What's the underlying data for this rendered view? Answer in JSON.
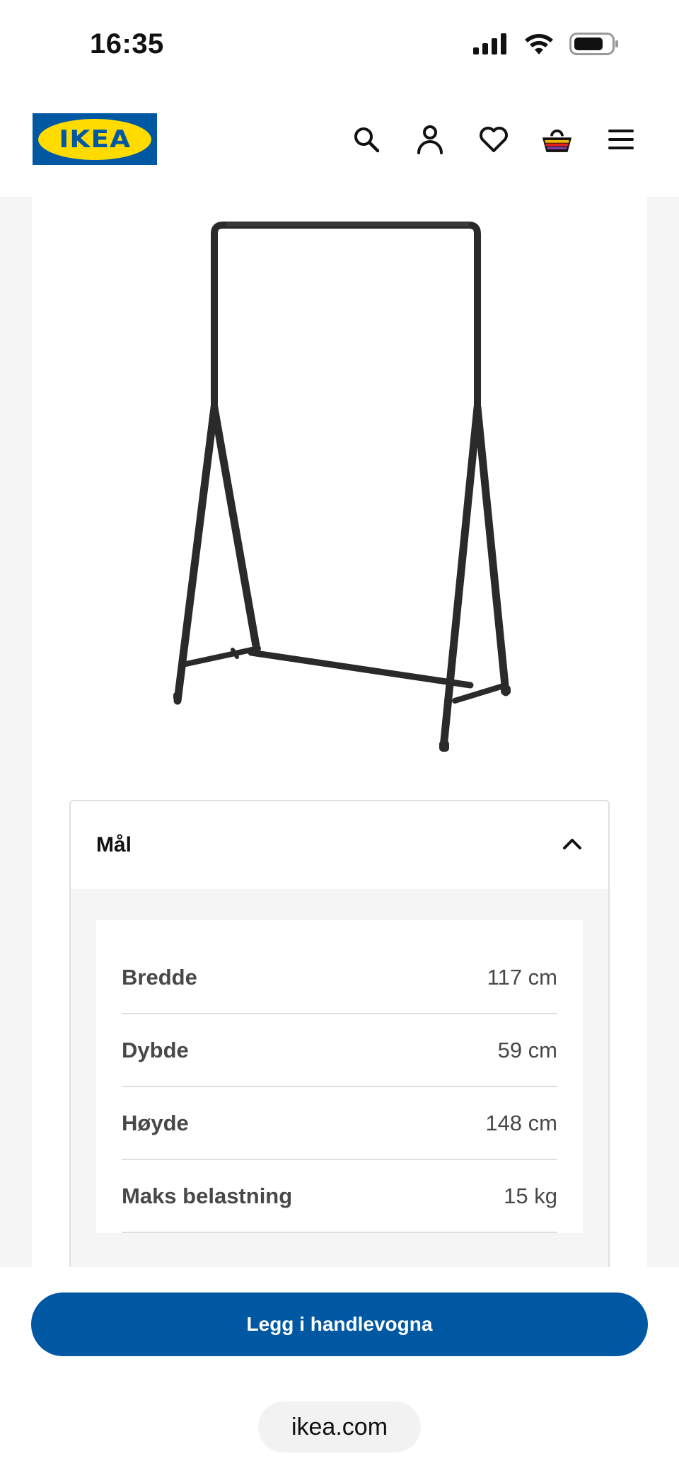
{
  "status_bar": {
    "time": "16:35",
    "icons": [
      "signal-icon",
      "wifi-icon",
      "battery-icon"
    ]
  },
  "header": {
    "logo_text": "IKEA",
    "icons": [
      "search-icon",
      "account-icon",
      "heart-icon",
      "cart-icon",
      "menu-icon"
    ]
  },
  "product": {
    "image": "clothes-rack-icon"
  },
  "dimensions": {
    "title": "Mål",
    "rows": [
      {
        "label": "Bredde",
        "value": "117 cm"
      },
      {
        "label": "Dybde",
        "value": "59 cm"
      },
      {
        "label": "Høyde",
        "value": "148 cm"
      },
      {
        "label": "Maks belastning",
        "value": "15 kg"
      }
    ]
  },
  "cta": {
    "label": "Legg i handlevogna"
  },
  "browser": {
    "url": "ikea.com"
  },
  "colors": {
    "brand_blue": "#0058a3",
    "brand_yellow": "#ffdb00"
  }
}
